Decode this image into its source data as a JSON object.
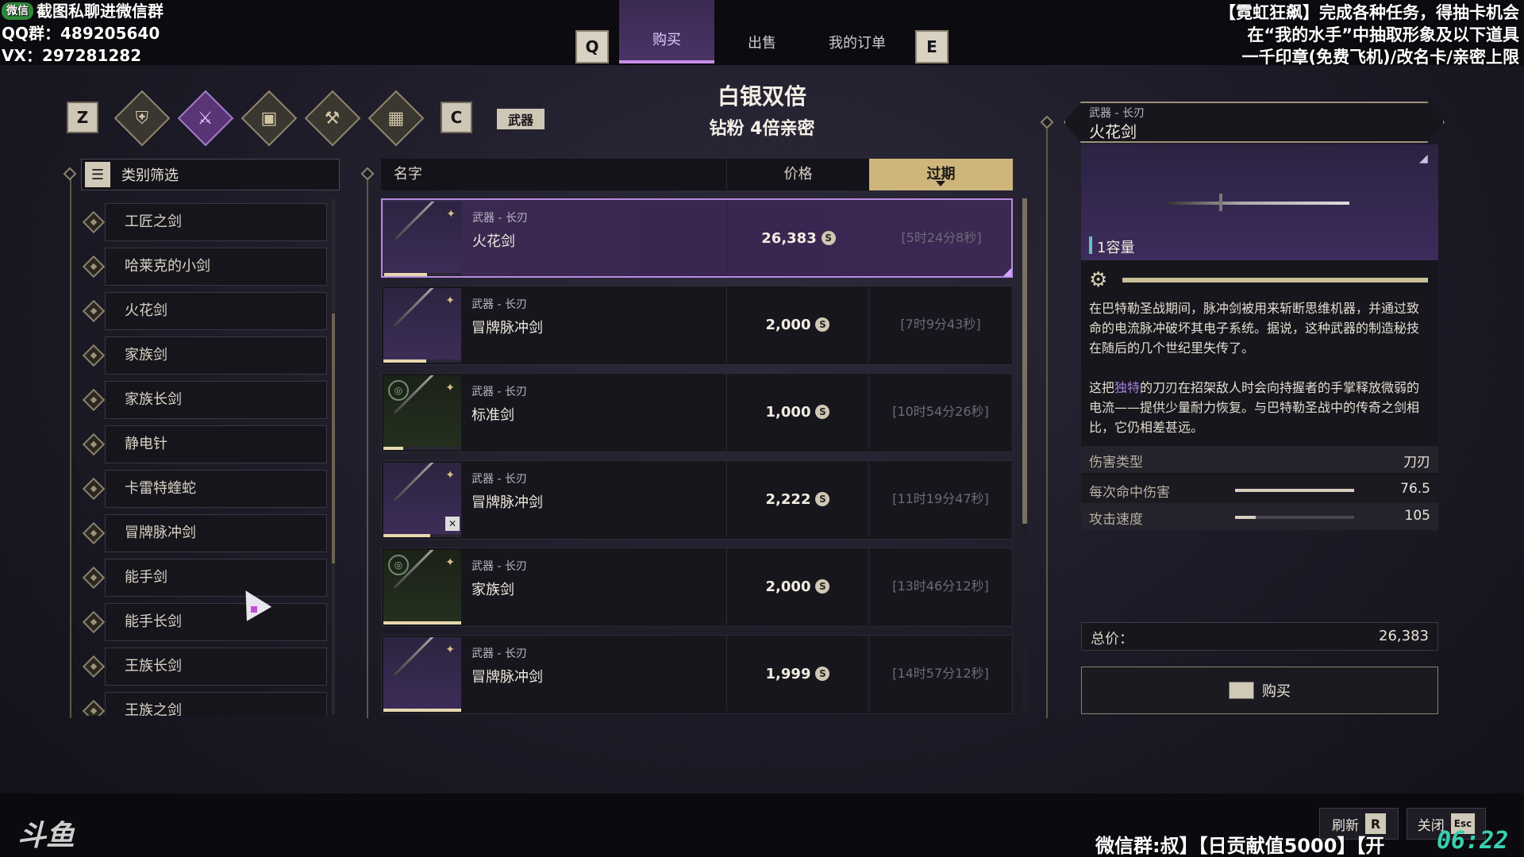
{
  "overlay": {
    "left_lines": [
      "截图私聊进微信群",
      "QQ群：489205640",
      "VX：297281282"
    ],
    "wechat_badge": "微信",
    "right_lines": [
      "【霓虹狂飙】完成各种任务，得抽卡机会",
      "在“我的水手”中抽取形象及以下道具",
      "一千印章(免费飞机)/改名卡/亲密上限"
    ]
  },
  "top_tabs": {
    "key_left": "Q",
    "key_right": "E",
    "buy": "购买",
    "sell": "出售",
    "orders": "我的订单"
  },
  "banner": {
    "title": "白银双倍",
    "subtitle": "钻粉 4倍亲密"
  },
  "category_bar": {
    "key_left": "Z",
    "key_right": "C",
    "active_label": "武器",
    "icons": [
      "armor-icon",
      "weapons-icon",
      "backpack-icon",
      "hammer-icon",
      "grid-icon"
    ]
  },
  "filter": {
    "label": "类别筛选",
    "items": [
      "工匠之剑",
      "哈莱克的小剑",
      "火花剑",
      "家族剑",
      "家族长剑",
      "静电针",
      "卡雷特蝰蛇",
      "冒牌脉冲剑",
      "能手剑",
      "能手长剑",
      "王族长剑",
      "王族之剑"
    ]
  },
  "listing_header": {
    "name": "名字",
    "price": "价格",
    "expiry": "过期"
  },
  "listings": [
    {
      "type": "武器 - 长刃",
      "name": "火花剑",
      "price": "26,383",
      "expiry": "[5时24分8秒]",
      "selected": true,
      "durability": 0.55,
      "variant": "purple"
    },
    {
      "type": "武器 - 长刃",
      "name": "冒牌脉冲剑",
      "price": "2,000",
      "expiry": "[7时9分43秒]",
      "selected": false,
      "durability": 0.55,
      "variant": "purple"
    },
    {
      "type": "武器 - 长刃",
      "name": "标准剑",
      "price": "1,000",
      "expiry": "[10时54分26秒]",
      "selected": false,
      "durability": 0.25,
      "variant": "green"
    },
    {
      "type": "武器 - 长刃",
      "name": "冒牌脉冲剑",
      "price": "2,222",
      "expiry": "[11时19分47秒]",
      "selected": false,
      "durability": 0.6,
      "variant": "purple"
    },
    {
      "type": "武器 - 长刃",
      "name": "家族剑",
      "price": "2,000",
      "expiry": "[13时46分12秒]",
      "selected": false,
      "durability": 1.0,
      "variant": "green"
    },
    {
      "type": "武器 - 长刃",
      "name": "冒牌脉冲剑",
      "price": "1,999",
      "expiry": "[14时57分12秒]",
      "selected": false,
      "durability": 1.0,
      "variant": "purple"
    }
  ],
  "coin_glyph": "S",
  "detail": {
    "type": "武器 - 长刃",
    "name": "火花剑",
    "capacity": "1容量",
    "desc_1": "在巴特勒圣战期间，脉冲剑被用来斩断思维机器，并通过致命的电流脉冲破坏其电子系统。据说，这种武器的制造秘技在随后的几个世纪里失传了。",
    "desc_2_pre": "这把",
    "desc_2_hl": "独特",
    "desc_2_post": "的刀刃在招架敌人时会向持握者的手掌释放微弱的电流——提供少量耐力恢复。与巴特勒圣战中的传奇之剑相比，它仍相差甚远。",
    "stats": [
      {
        "label": "伤害类型",
        "value": "刀刃",
        "fill": null
      },
      {
        "label": "每次命中伤害",
        "value": "76.5",
        "fill": 1.0
      },
      {
        "label": "攻击速度",
        "value": "105",
        "fill": 0.17
      }
    ],
    "total_label": "总价：",
    "total_value": "26,383",
    "buy_label": "购买"
  },
  "bottom": {
    "refresh_label": "刷新",
    "refresh_key": "R",
    "close_label": "关闭",
    "close_key": "Esc",
    "logo": "斗鱼",
    "ticker": "微信群:叔】【日贡献值5000】【开",
    "clock": "06:22"
  },
  "colors": {
    "accent_purple": "#b58be0",
    "gold": "#cdb57c",
    "teal": "#38d0b0"
  }
}
